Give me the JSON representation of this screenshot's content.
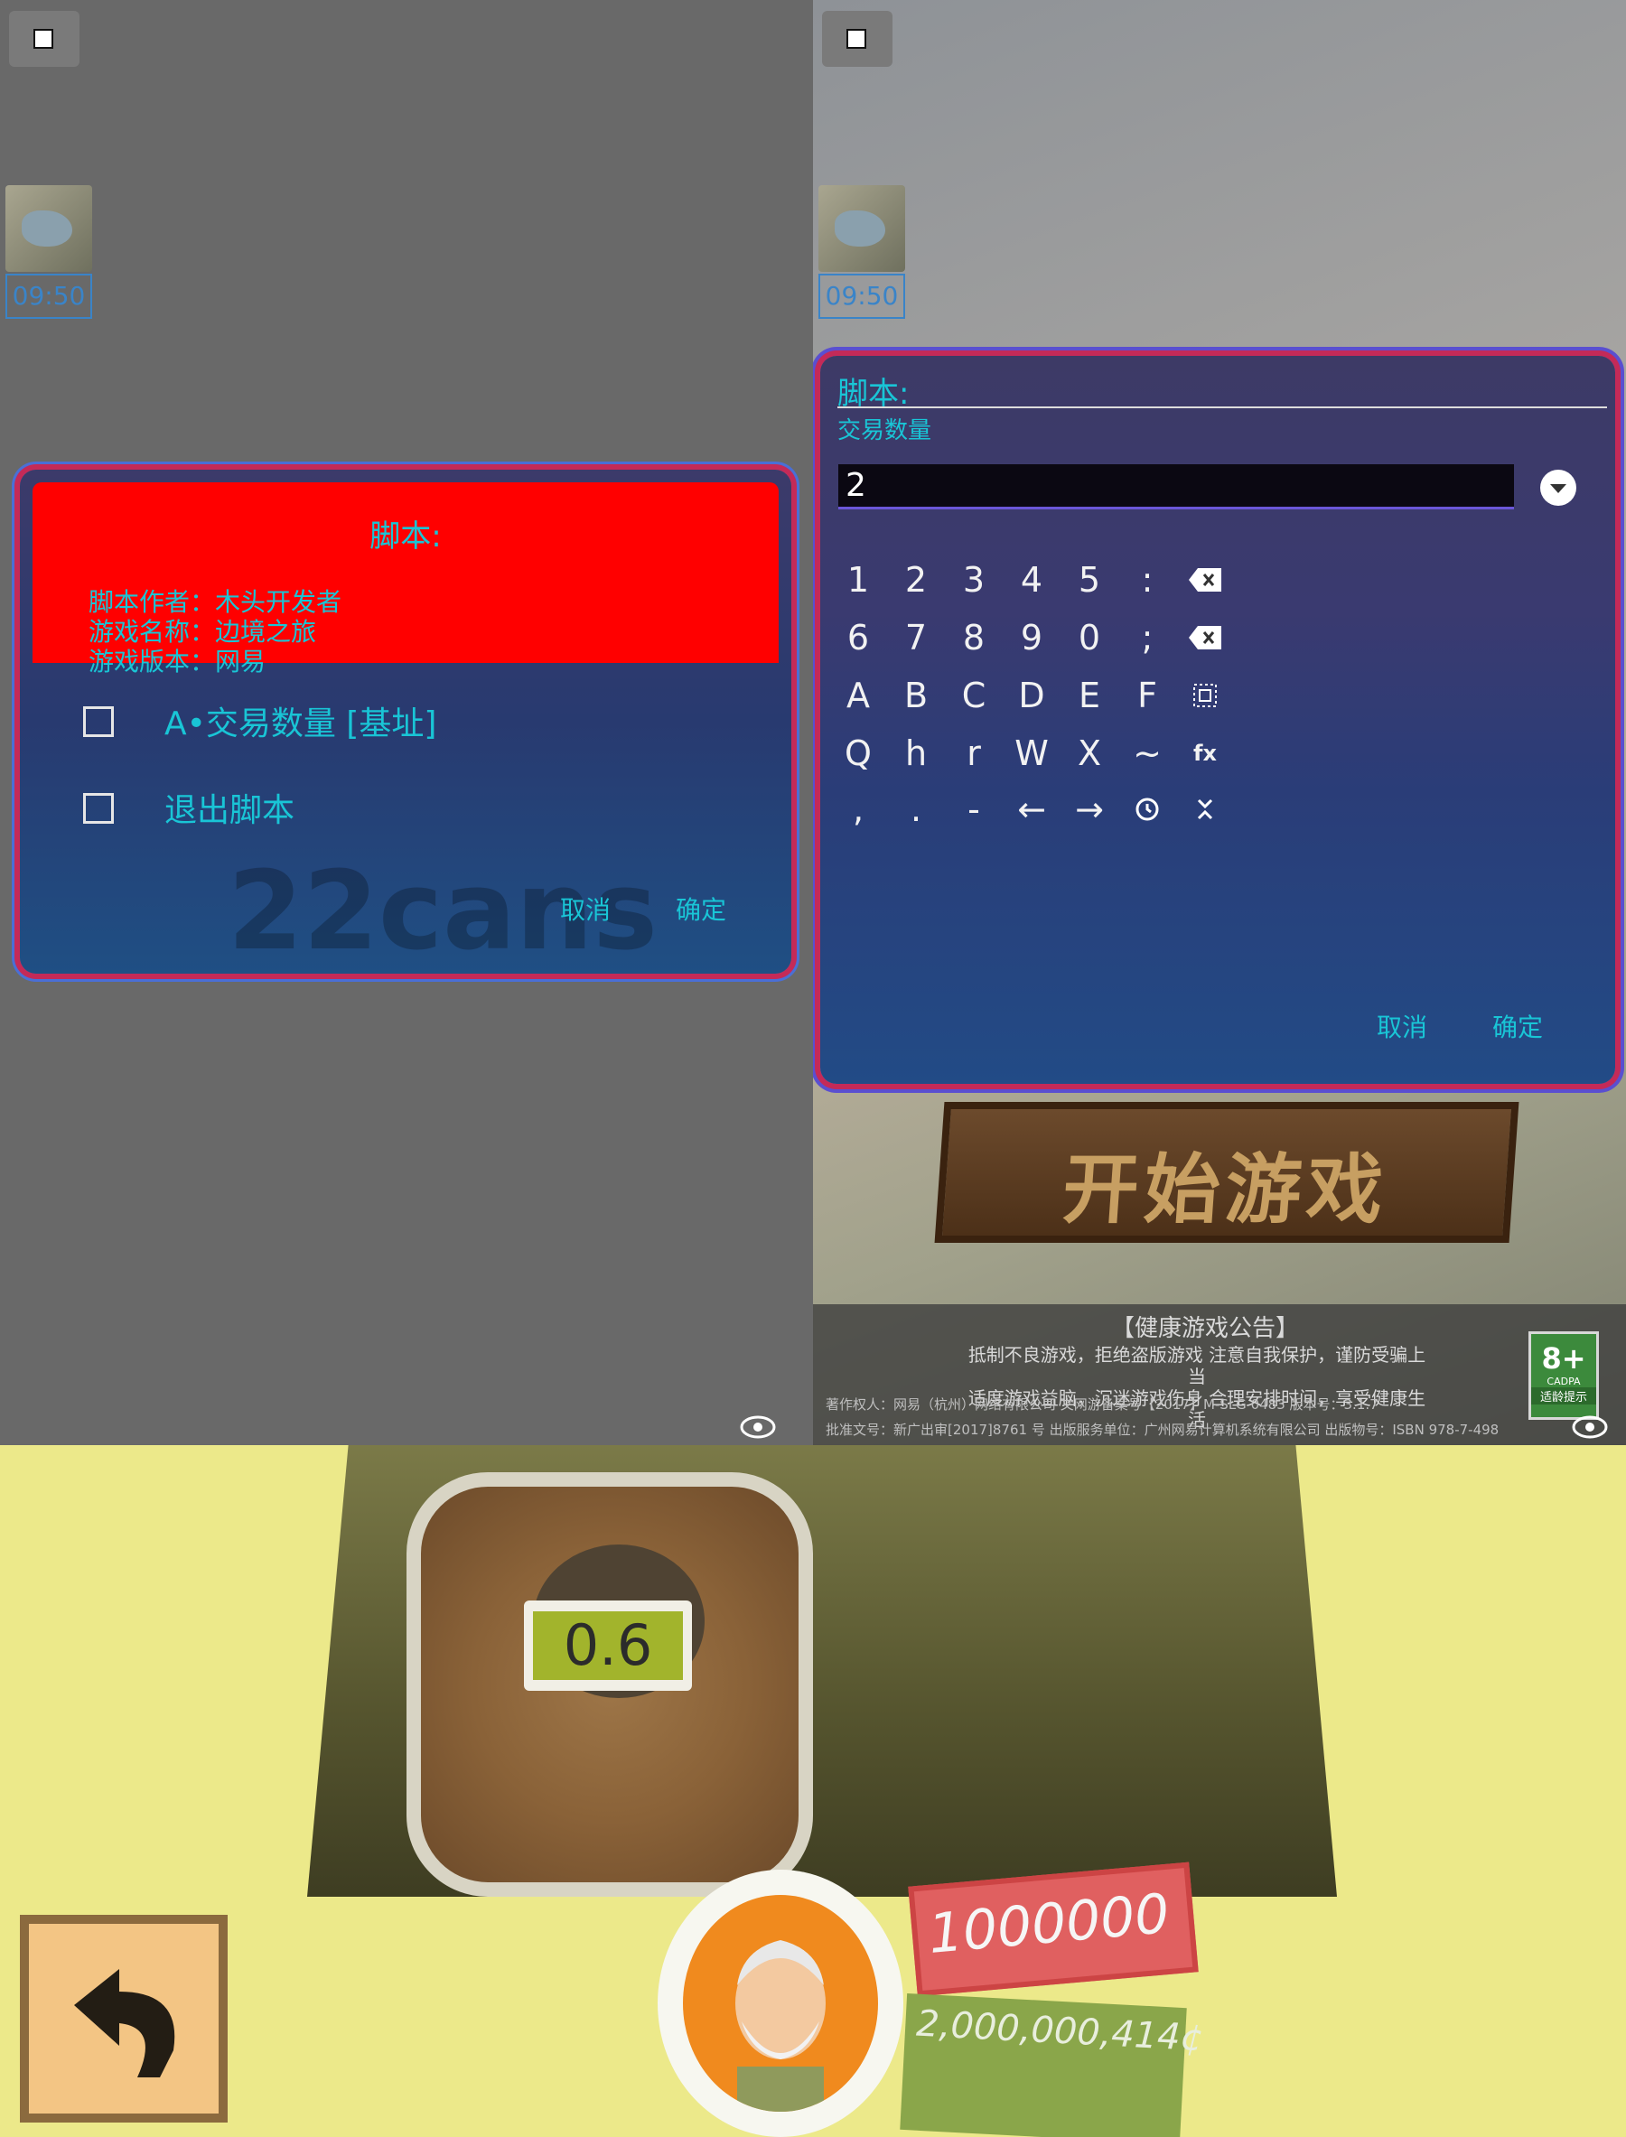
{
  "left": {
    "time": "09:50",
    "dialog": {
      "title": "脚本:",
      "info_lines": [
        "脚本作者：木头开发者",
        "游戏名称：边境之旅",
        "游戏版本：网易"
      ],
      "options": [
        {
          "label": "A•交易数量 [基址]",
          "checked": false
        },
        {
          "label": "退出脚本",
          "checked": false
        }
      ],
      "cancel": "取消",
      "confirm": "确定"
    },
    "watermark": "22cans"
  },
  "right": {
    "time": "09:50",
    "dialog": {
      "title": "脚本:",
      "subtitle": "交易数量",
      "input_value": "2",
      "keyboard_rows": [
        [
          "1",
          "2",
          "3",
          "4",
          "5",
          ":",
          "backspace"
        ],
        [
          "6",
          "7",
          "8",
          "9",
          "0",
          ";",
          "clear"
        ],
        [
          "A",
          "B",
          "C",
          "D",
          "E",
          "F",
          "select-all"
        ],
        [
          "Q",
          "h",
          "r",
          "W",
          "X",
          "~",
          "fx"
        ],
        [
          ",",
          ".",
          "-",
          "←",
          "→",
          "history",
          "collapse"
        ]
      ],
      "cancel": "取消",
      "confirm": "确定"
    },
    "start_banner": "开始游戏",
    "notice": {
      "title": "【健康游戏公告】",
      "line1": "抵制不良游戏，拒绝盗版游戏 注意自我保护，谨防受骗上当",
      "line2": "适度游戏益脑，沉迷游戏伤身 合理安排时间，享受健康生活",
      "fine1": "著作权人：网易（杭州）网络有限公司 文网游备案号【2017】M-SLG 0483          版本号：3.1.7",
      "fine2": "批准文号：新广出审[2017]8761 号      出版服务单位：广州网易计算机系统有限公司 出版物号：ISBN 978-7-498"
    },
    "age_badge": {
      "rating": "8+",
      "org": "CADPA",
      "caption": "适龄提示"
    }
  },
  "game": {
    "price": "0.6",
    "coins": "1000000",
    "gold": "2,000,000,414¢"
  },
  "colors": {
    "accent_cyan": "#19c5d6",
    "header_red": "#ff0000",
    "border_pink": "#c42a58"
  }
}
